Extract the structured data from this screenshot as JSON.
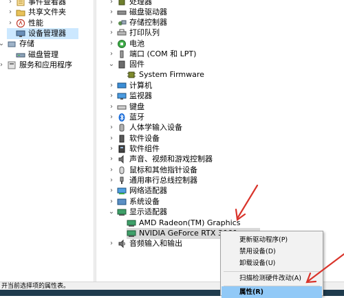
{
  "left_tree": [
    {
      "label": "事件查看器",
      "icon": "event-viewer-icon"
    },
    {
      "label": "共享文件夹",
      "icon": "shared-folder-icon"
    },
    {
      "label": "性能",
      "icon": "performance-icon"
    },
    {
      "label": "设备管理器",
      "icon": "device-manager-icon",
      "selected": true
    },
    {
      "label": "存储",
      "icon": "storage-icon"
    },
    {
      "label": "磁盘管理",
      "icon": "disk-management-icon"
    },
    {
      "label": "服务和应用程序",
      "icon": "services-apps-icon"
    }
  ],
  "device_tree": [
    {
      "label": "处理器",
      "icon": "processor-icon"
    },
    {
      "label": "磁盘驱动器",
      "icon": "disk-drive-icon"
    },
    {
      "label": "存储控制器",
      "icon": "storage-controller-icon"
    },
    {
      "label": "打印队列",
      "icon": "printer-icon"
    },
    {
      "label": "电池",
      "icon": "battery-icon"
    },
    {
      "label": "端口 (COM 和 LPT)",
      "icon": "port-icon"
    },
    {
      "label": "固件",
      "icon": "firmware-icon",
      "expanded": true
    },
    {
      "label": "System Firmware",
      "icon": "firmware-chip-icon",
      "child": true
    },
    {
      "label": "计算机",
      "icon": "computer-icon"
    },
    {
      "label": "监视器",
      "icon": "monitor-icon"
    },
    {
      "label": "键盘",
      "icon": "keyboard-icon"
    },
    {
      "label": "蓝牙",
      "icon": "bluetooth-icon"
    },
    {
      "label": "人体学输入设备",
      "icon": "hid-icon"
    },
    {
      "label": "软件设备",
      "icon": "software-device-icon"
    },
    {
      "label": "软件组件",
      "icon": "software-component-icon"
    },
    {
      "label": "声音、视频和游戏控制器",
      "icon": "sound-icon"
    },
    {
      "label": "鼠标和其他指针设备",
      "icon": "mouse-icon"
    },
    {
      "label": "通用串行总线控制器",
      "icon": "usb-icon"
    },
    {
      "label": "网络适配器",
      "icon": "network-adapter-icon"
    },
    {
      "label": "系统设备",
      "icon": "system-device-icon"
    },
    {
      "label": "显示适配器",
      "icon": "display-adapter-icon",
      "expanded": true
    },
    {
      "label": "AMD Radeon(TM) Graphics",
      "icon": "gpu-icon",
      "child": true
    },
    {
      "label": "NVIDIA GeForce RTX 3060",
      "icon": "gpu-icon",
      "child": true,
      "selected": true
    },
    {
      "label": "音频输入和输出",
      "icon": "audio-io-icon"
    }
  ],
  "context_menu": [
    {
      "label": "更新驱动程序(P)"
    },
    {
      "label": "禁用设备(D)"
    },
    {
      "label": "卸载设备(U)"
    },
    {
      "label": "扫描检测硬件改动(A)"
    },
    {
      "label": "属性(R)",
      "highlighted": true
    }
  ],
  "status_text": "开当前选择项的属性表。",
  "colors": {
    "selection": "#cce8ff",
    "menu_highlight": "#91c9f7",
    "arrow": "#d9342b"
  }
}
